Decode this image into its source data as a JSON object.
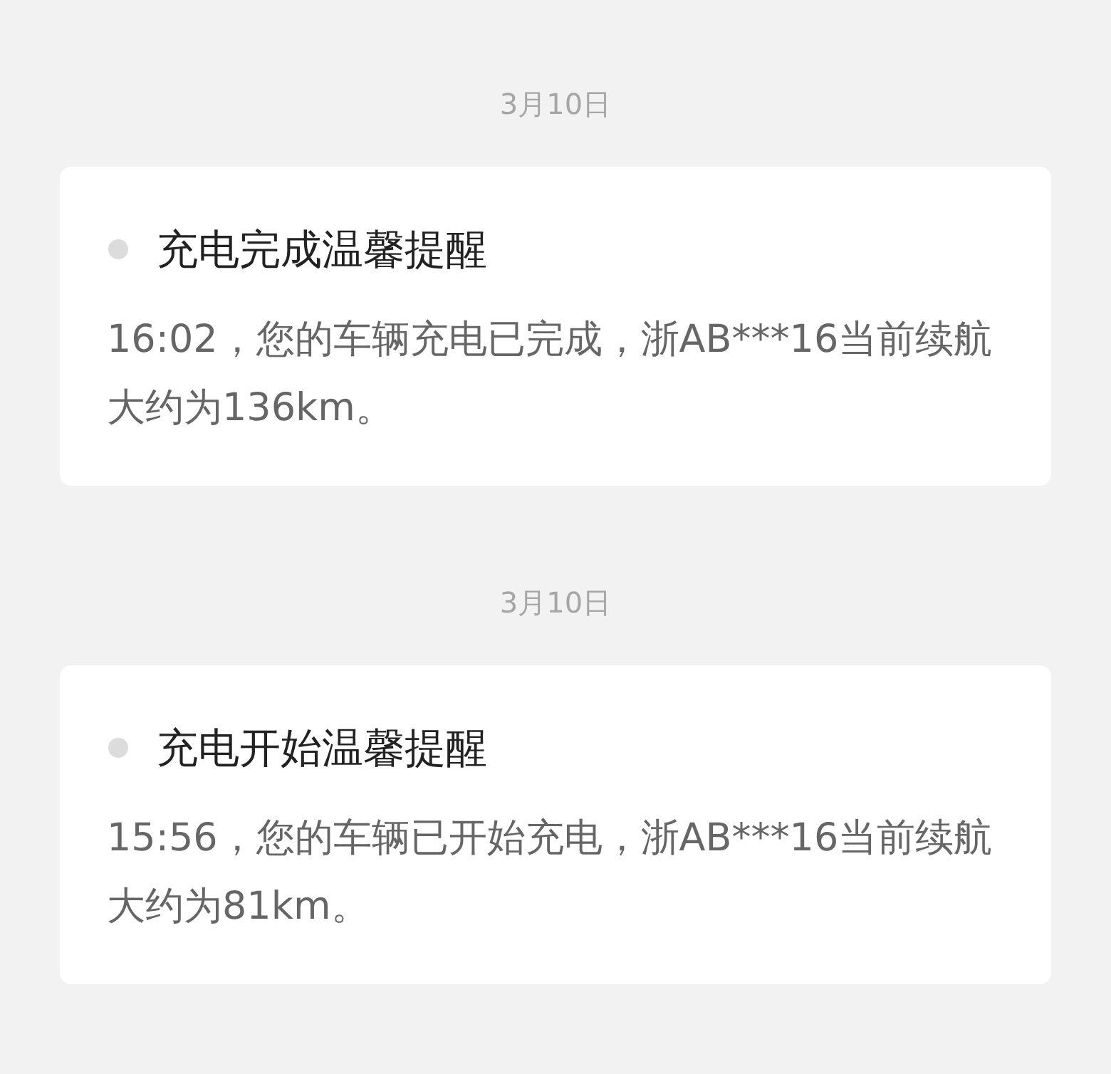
{
  "messages": [
    {
      "date": "3月10日",
      "title": "充电完成温馨提醒",
      "body": "16:02，您的车辆充电已完成，浙AB***16当前续航大约为136km。"
    },
    {
      "date": "3月10日",
      "title": "充电开始温馨提醒",
      "body": "15:56，您的车辆已开始充电，浙AB***16当前续航大约为81km。"
    }
  ]
}
